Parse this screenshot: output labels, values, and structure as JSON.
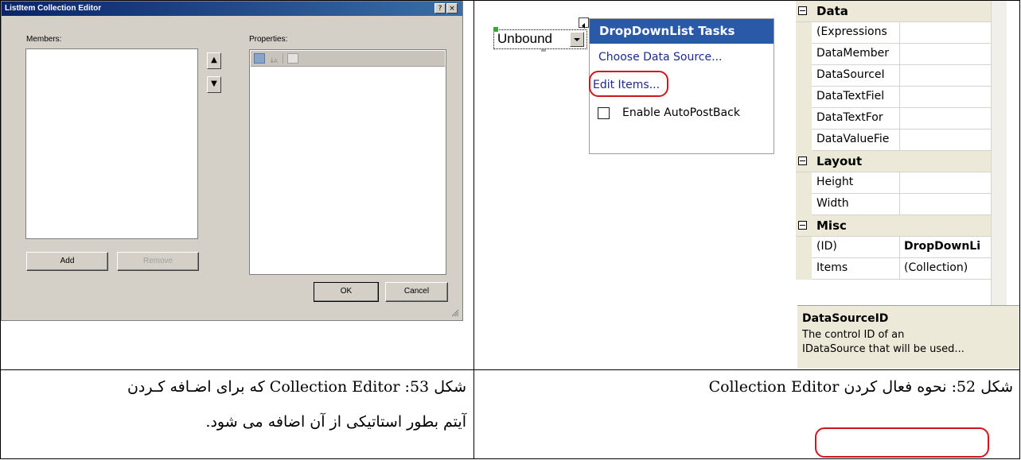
{
  "dialog": {
    "title": "ListItem Collection Editor",
    "title_buttons": [
      "?",
      "×"
    ],
    "members_label": "Members:",
    "properties_label": "Properties:",
    "add_label": "Add",
    "remove_label": "Remove",
    "ok_label": "OK",
    "cancel_label": "Cancel"
  },
  "designer": {
    "control_text": "Unbound",
    "tasks_title": "DropDownList Tasks",
    "tasks": {
      "choose_source": "Choose Data Source...",
      "edit_items": "Edit Items...",
      "autopostback": "Enable AutoPostBack"
    }
  },
  "property_grid": {
    "categories": [
      {
        "name": "Data",
        "rows": [
          {
            "name": "(Expressions",
            "value": ""
          },
          {
            "name": "DataMember",
            "value": ""
          },
          {
            "name": "DataSourceI",
            "value": ""
          },
          {
            "name": "DataTextFiel",
            "value": ""
          },
          {
            "name": "DataTextFor",
            "value": ""
          },
          {
            "name": "DataValueFie",
            "value": ""
          }
        ]
      },
      {
        "name": "Layout",
        "rows": [
          {
            "name": "Height",
            "value": ""
          },
          {
            "name": "Width",
            "value": ""
          }
        ]
      },
      {
        "name": "Misc",
        "rows": [
          {
            "name": "(ID)",
            "value": "DropDownLi"
          },
          {
            "name": "Items",
            "value": "(Collection)"
          }
        ]
      }
    ],
    "description_title": "DataSourceID",
    "description_line1": "The control ID of an",
    "description_line2": "IDataSource that will be used..."
  },
  "captions": {
    "right_fig": "شکل 52: نحوه فعال کردن Collection Editor",
    "left_fig_line1": "شکل 53: Collection  Editor که برای اضـافه کـردن",
    "left_fig_line2": "آیتم بطور استاتیکی از آن اضافه می شود."
  },
  "colors": {
    "highlight_ring": "#d0151c",
    "tasks_header": "#2a59a8"
  }
}
